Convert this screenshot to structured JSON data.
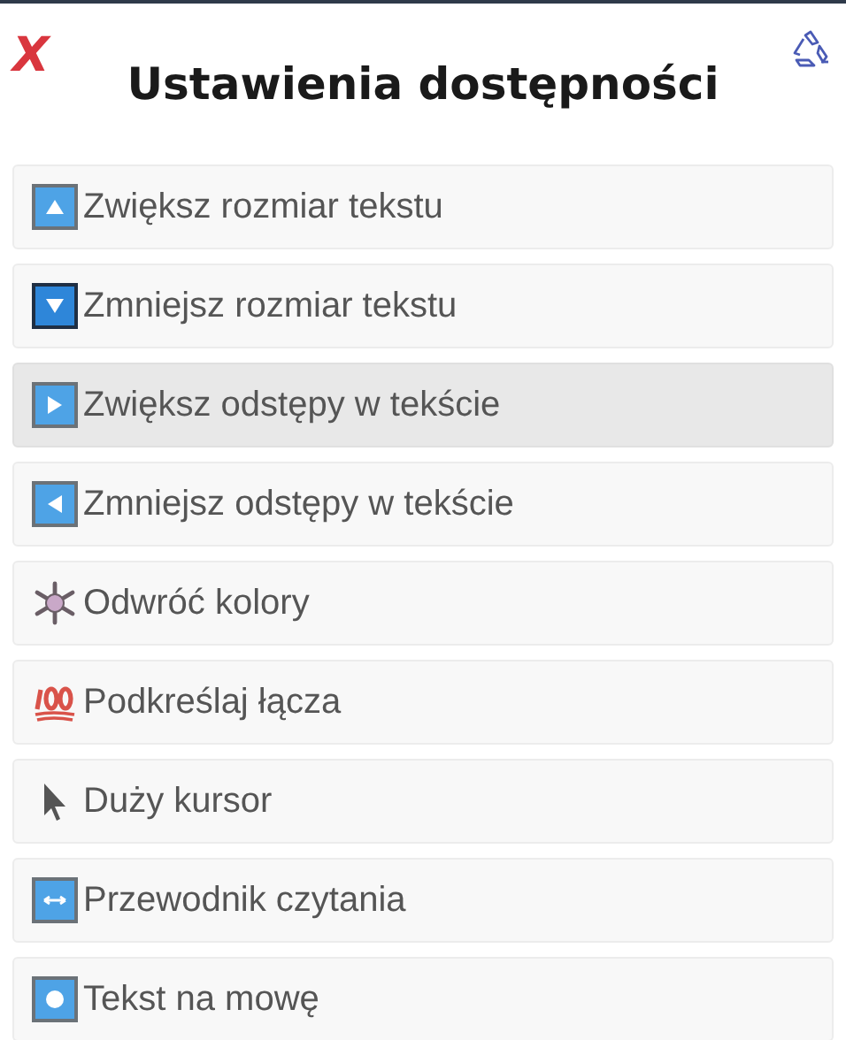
{
  "close_label": "X",
  "title": "Ustawienia dostępności",
  "items": [
    {
      "kind": "up",
      "label": "Zwiększ rozmiar tekstu",
      "selected": false
    },
    {
      "kind": "down",
      "label": "Zmniejsz rozmiar tekstu",
      "selected": false
    },
    {
      "kind": "right",
      "label": "Zwiększ odstępy w tekście",
      "selected": true
    },
    {
      "kind": "left",
      "label": "Zmniejsz odstępy w tekście",
      "selected": false
    },
    {
      "kind": "snowflake",
      "label": "Odwróć kolory",
      "selected": false
    },
    {
      "kind": "hundred",
      "label": "Podkreślaj łącza",
      "selected": false
    },
    {
      "kind": "cursor",
      "label": "Duży kursor",
      "selected": false
    },
    {
      "kind": "arrows",
      "label": "Przewodnik czytania",
      "selected": false
    },
    {
      "kind": "dot",
      "label": "Tekst na mowę",
      "selected": false
    }
  ]
}
